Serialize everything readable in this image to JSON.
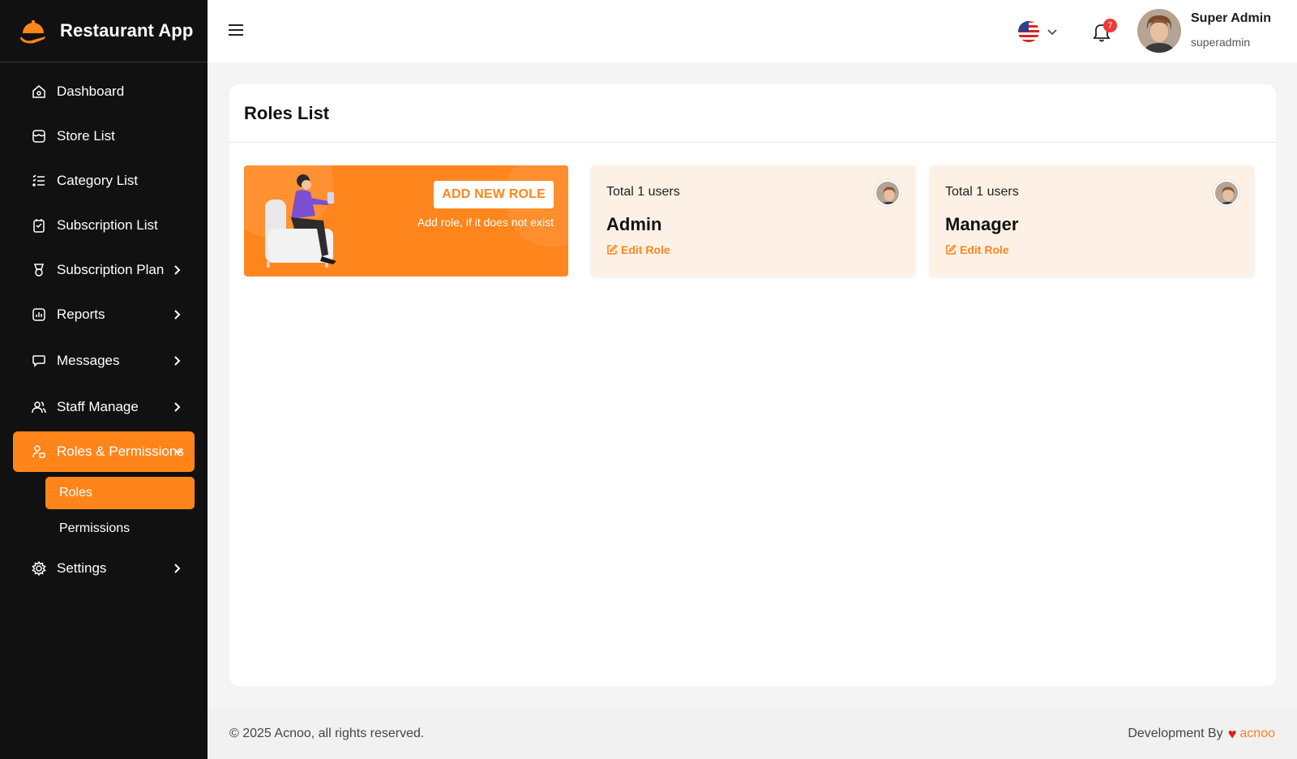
{
  "app": {
    "name": "Restaurant App"
  },
  "sidebar": {
    "items": [
      {
        "label": "Dashboard",
        "icon": "home-icon"
      },
      {
        "label": "Store List",
        "icon": "store-icon"
      },
      {
        "label": "Category List",
        "icon": "list-icon"
      },
      {
        "label": "Subscription List",
        "icon": "clipboard-icon"
      },
      {
        "label": "Subscription Plan",
        "icon": "trophy-icon",
        "expandable": true
      },
      {
        "label": "Reports",
        "icon": "report-icon",
        "expandable": true
      },
      {
        "label": "Messages",
        "icon": "message-icon",
        "expandable": true
      },
      {
        "label": "Staff Manage",
        "icon": "users-icon",
        "expandable": true
      },
      {
        "label": "Roles & Permissions",
        "icon": "role-icon",
        "expandable": true,
        "active": true
      },
      {
        "label": "Settings",
        "icon": "gear-icon",
        "expandable": true
      }
    ],
    "sub_items": [
      {
        "label": "Roles",
        "active": true
      },
      {
        "label": "Permissions"
      }
    ]
  },
  "header": {
    "notifications_count": "7",
    "user": {
      "name": "Super Admin",
      "handle": "superadmin"
    }
  },
  "main": {
    "title": "Roles List",
    "add_card": {
      "button_label": "ADD NEW ROLE",
      "hint": "Add role, if it does not exist"
    },
    "roles": [
      {
        "users_text": "Total 1 users",
        "name": "Admin",
        "edit_label": "Edit Role"
      },
      {
        "users_text": "Total 1 users",
        "name": "Manager",
        "edit_label": "Edit Role"
      }
    ]
  },
  "footer": {
    "copyright": "© 2025 Acnoo, all rights reserved.",
    "dev_prefix": "Development By",
    "dev_link": "acnoo"
  },
  "colors": {
    "accent": "#ff851b",
    "sidebar_bg": "#111111",
    "role_card_bg": "#fdf1e6"
  }
}
